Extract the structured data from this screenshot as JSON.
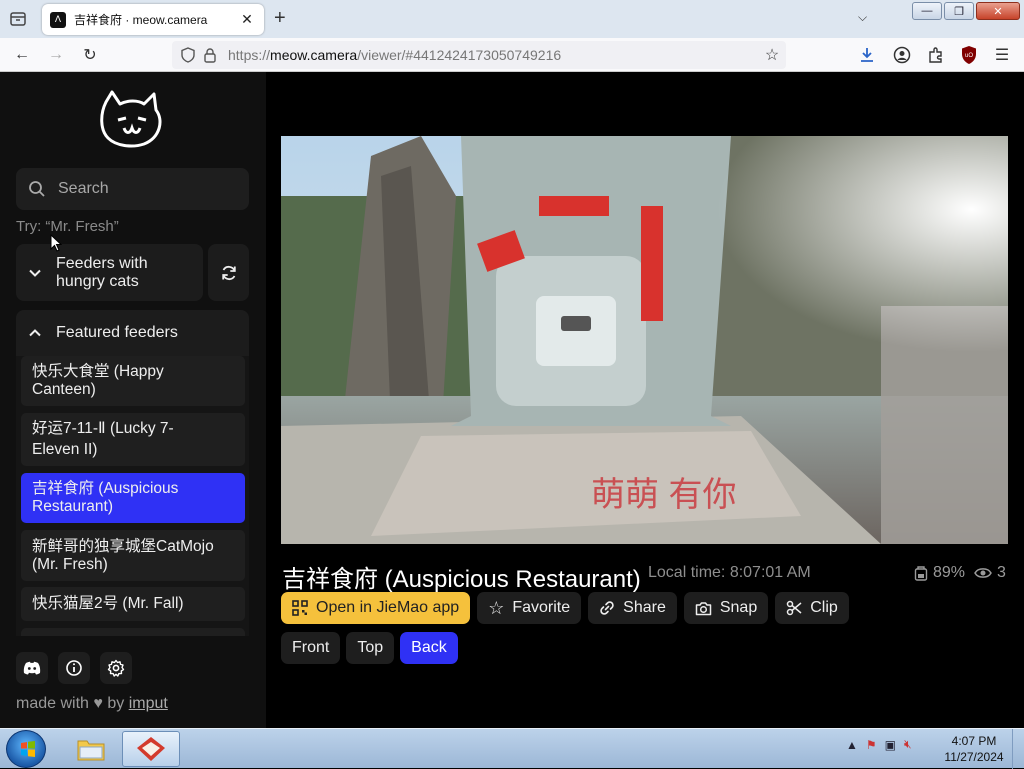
{
  "browser": {
    "tab_title": "吉祥食府 · meow.camera",
    "tab_close": "✕",
    "new_tab": "+",
    "url_domain": "meow.camera",
    "url_prefix": "https://",
    "url_path": "/viewer/#4412424173050749216"
  },
  "sidebar": {
    "search_placeholder": "Search",
    "hint": "Try: “Mr. Fresh”",
    "hungry_label_line1": "Feeders with",
    "hungry_label_line2": "hungry cats",
    "featured_label": "Featured feeders",
    "feeders": [
      {
        "line1": "快乐大食堂 (Happy",
        "line2": "Canteen)"
      },
      {
        "line1": "好运7-11-Ⅱ (Lucky 7-",
        "line2": "Eleven II)"
      },
      {
        "line1": "吉祥食府 (Auspicious",
        "line2": "Restaurant)"
      },
      {
        "line1": "新鲜哥的独享城堡CatMojo",
        "line2": "(Mr. Fresh)"
      },
      {
        "line1": "快乐猫屋2号 (Mr. Fall)",
        "line2": ""
      }
    ],
    "made_with": "made with",
    "by": "by",
    "author": "imput"
  },
  "viewer": {
    "title": "吉祥食府 (Auspicious Restaurant)",
    "local_time": "Local time: 8:07:01 AM",
    "battery": "89%",
    "viewers": "3",
    "actions": {
      "open_app": "Open in JieMao app",
      "favorite": "Favorite",
      "share": "Share",
      "snap": "Snap",
      "clip": "Clip"
    },
    "views": {
      "front": "Front",
      "top": "Top",
      "back": "Back"
    },
    "active_view": "Back"
  },
  "taskbar": {
    "time": "4:07 PM",
    "date": "11/27/2024"
  },
  "colors": {
    "accent_blue": "#2f31f5",
    "primary_yellow": "#f5c13c",
    "sidebar_bg": "#101010"
  }
}
